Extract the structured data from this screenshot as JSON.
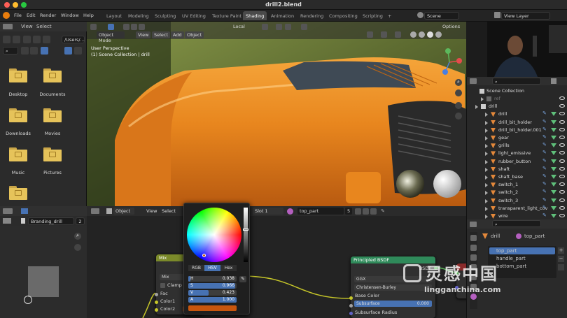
{
  "window": {
    "title": "drill2.blend"
  },
  "topbar": {
    "menus": [
      "File",
      "Edit",
      "Render",
      "Window",
      "Help"
    ],
    "workspaces": [
      "Layout",
      "Modeling",
      "Sculpting",
      "UV Editing",
      "Texture Paint",
      "Shading",
      "Animation",
      "Rendering",
      "Compositing",
      "Scripting"
    ],
    "add_tab": "+",
    "scene": "Scene",
    "view_layer": "View Layer"
  },
  "filebrowser": {
    "menus": [
      "View",
      "Select"
    ],
    "path": "/Users/...",
    "items": [
      {
        "label": "Desktop"
      },
      {
        "label": "Documents"
      },
      {
        "label": "Downloads"
      },
      {
        "label": "Movies"
      },
      {
        "label": "Music"
      },
      {
        "label": "Pictures"
      },
      {
        "label": ""
      }
    ]
  },
  "viewport": {
    "mode": "Object Mode",
    "menus": [
      "View",
      "Select",
      "Add",
      "Object"
    ],
    "transform": "Local",
    "info_line1": "User Perspective",
    "info_line2": "(1) Scene Collection | drill",
    "options": "Options"
  },
  "outliner": {
    "root": "Scene Collection",
    "rows": [
      {
        "label": "ref",
        "dim": true
      },
      {
        "label": "drill"
      },
      {
        "label": "drill"
      },
      {
        "label": "drill_bit_holder"
      },
      {
        "label": "drill_bit_holder.001"
      },
      {
        "label": "gear"
      },
      {
        "label": "grills"
      },
      {
        "label": "light_emissive"
      },
      {
        "label": "rubber_button"
      },
      {
        "label": "shaft"
      },
      {
        "label": "shaft_base"
      },
      {
        "label": "switch_1"
      },
      {
        "label": "switch_2"
      },
      {
        "label": "switch_3"
      },
      {
        "label": "transparent_light_cov"
      },
      {
        "label": "wire"
      }
    ]
  },
  "imgeditor": {
    "image_name": "Branding_drill",
    "users": "2"
  },
  "nodeeditor": {
    "object_mode": "Object",
    "menus": [
      "View",
      "Select"
    ],
    "slot": "Slot 1",
    "material": "top_part",
    "material_users": "5",
    "mix_node": {
      "title": "Mix",
      "type": "Mix",
      "clamp": "Clamp",
      "inputs": [
        "Fac",
        "Color1",
        "Color2"
      ]
    },
    "bsdf_node": {
      "title": "Principled BSDF",
      "output": "BSDF",
      "distribution": "GGX",
      "subsurface_method": "Christensen-Burley",
      "base_color": "Base Color",
      "subsurface_label": "Subsurface",
      "subsurface_value": "0.000",
      "subsurface_radius": "Subsurface Radius"
    }
  },
  "picker": {
    "tabs": [
      "RGB",
      "HSV",
      "Hex"
    ],
    "active_tab": "HSV",
    "values": {
      "H": "0.038",
      "S": "0.966",
      "V": "0.423",
      "A": "1.000"
    },
    "fills": {
      "H": 0.038,
      "S": 0.966,
      "V": 0.423,
      "A": 1.0
    },
    "swatch_color": "#c8560e"
  },
  "props": {
    "object": "drill",
    "material": "top_part",
    "slots": [
      "top_part",
      "handle_part",
      "bottom_part"
    ]
  },
  "watermark": {
    "text1": "灵感中国",
    "text2": "lingganchina.com"
  }
}
